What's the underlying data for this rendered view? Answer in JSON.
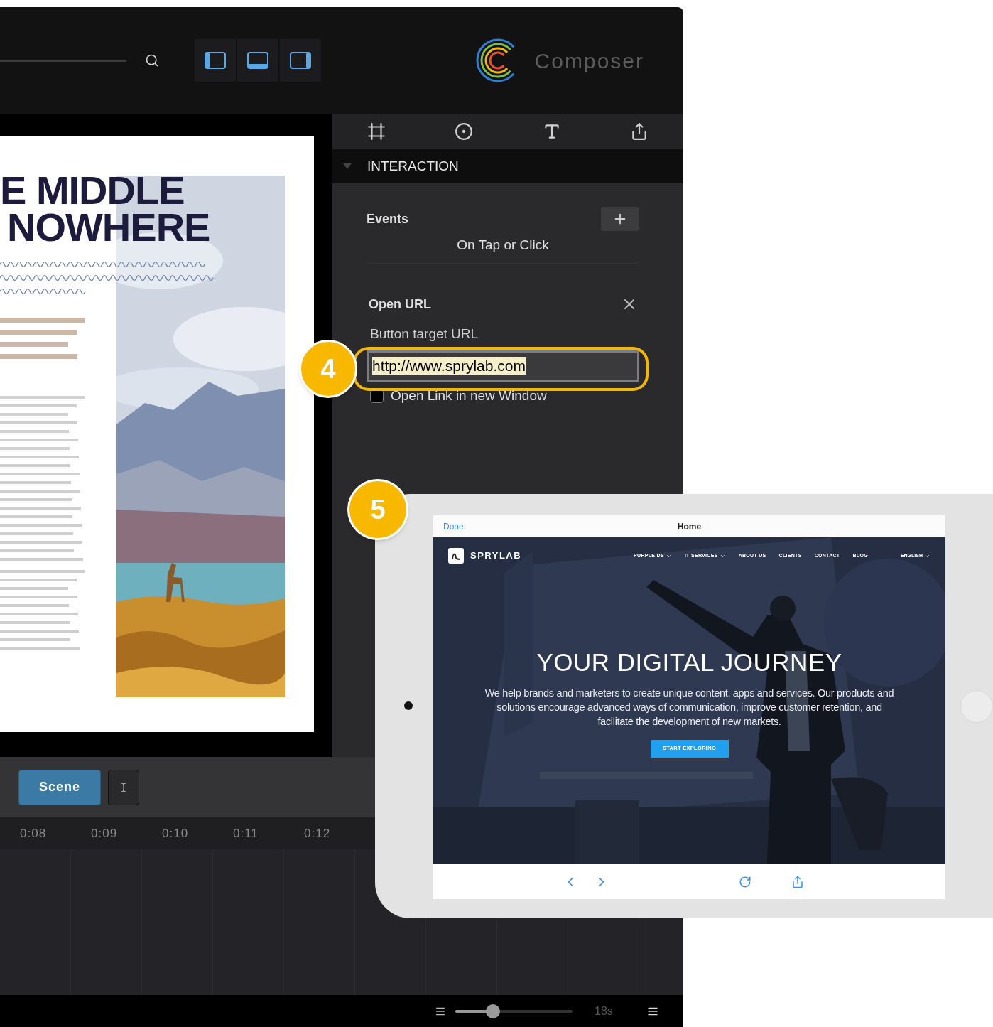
{
  "app": {
    "logo_text": "Composer"
  },
  "inspector": {
    "section": {
      "title": "INTERACTION",
      "expanded": true
    },
    "events": {
      "label": "Events",
      "items": [
        "On Tap or Click"
      ]
    },
    "action": {
      "title": "Open URL",
      "field_label": "Button target URL",
      "url": "http://www.sprylab.com",
      "new_window": {
        "label": "Open Link in new Window",
        "checked": false
      }
    }
  },
  "document": {
    "headline": [
      "E MIDDLE",
      "NOWHERE"
    ]
  },
  "timeline": {
    "scene_button": "Scene",
    "ticks": [
      "0:08",
      "0:09",
      "0:10",
      "0:11",
      "0:12"
    ],
    "zoom": {
      "level": 0.32
    },
    "duration": "18s"
  },
  "callouts": [
    "4",
    "5"
  ],
  "preview": {
    "done": "Done",
    "title": "Home",
    "brand": "SPRYLAB",
    "nav": [
      {
        "label": "PURPLE DS",
        "dropdown": true
      },
      {
        "label": "IT SERVICES",
        "dropdown": true
      },
      {
        "label": "ABOUT US",
        "dropdown": false
      },
      {
        "label": "CLIENTS",
        "dropdown": false
      },
      {
        "label": "CONTACT",
        "dropdown": false
      },
      {
        "label": "BLOG",
        "dropdown": false
      }
    ],
    "language": "ENGLISH",
    "headline": "YOUR DIGITAL JOURNEY",
    "body": "We help brands and marketers to create unique content, apps and services. Our products and solutions encourage advanced ways of communication, improve customer retention, and facilitate the development of new markets.",
    "cta": "START EXPLORING"
  }
}
